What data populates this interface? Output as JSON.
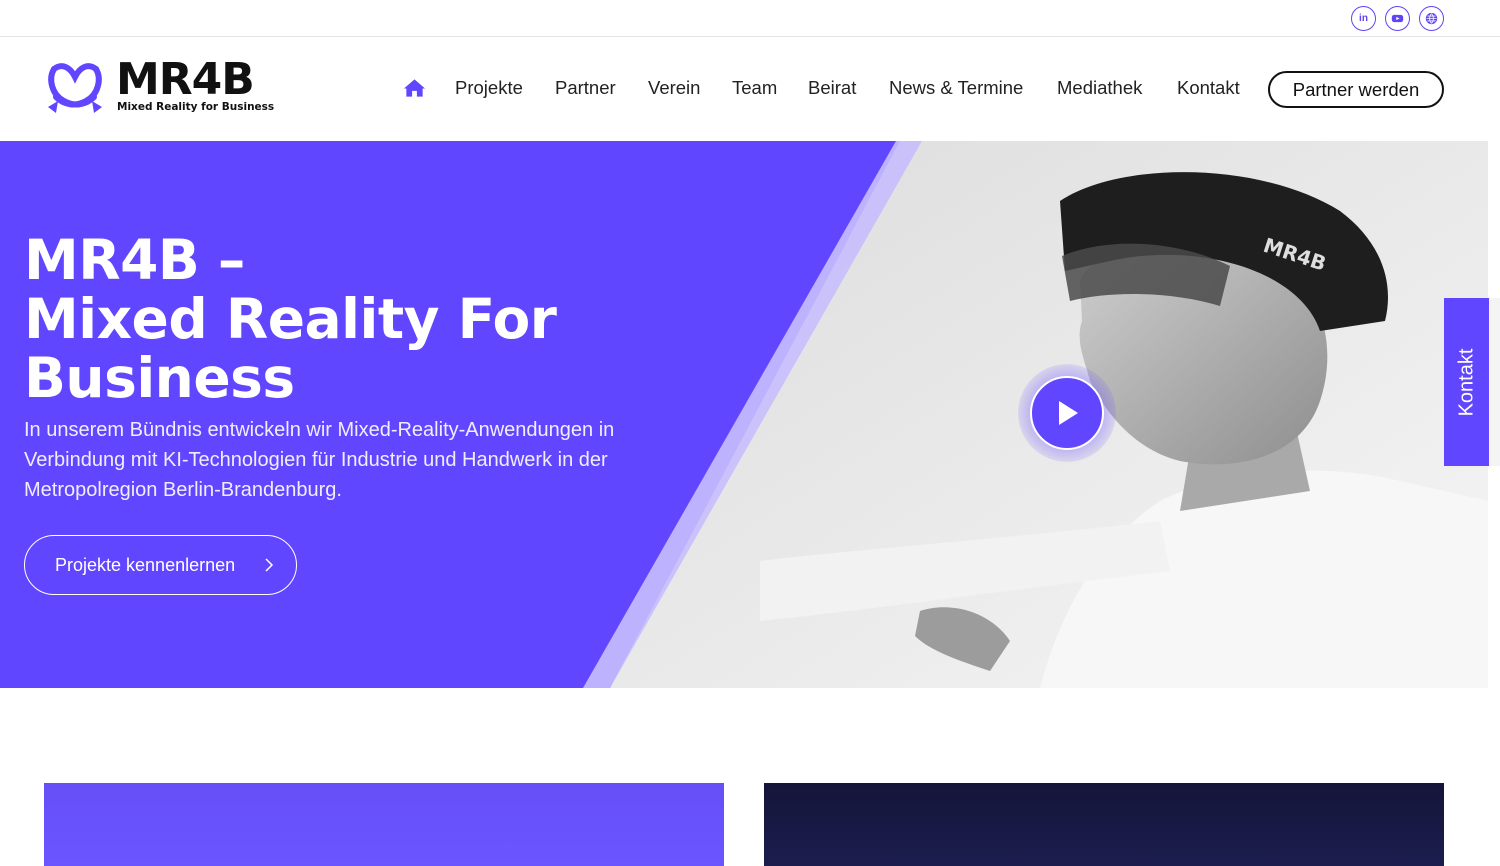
{
  "brand": {
    "logo_text": "MR4B",
    "tagline": "Mixed Reality for Business",
    "accent_color": "#6146ff"
  },
  "social": [
    {
      "icon": "linkedin-icon",
      "label": "in"
    },
    {
      "icon": "youtube-icon"
    },
    {
      "icon": "globe-icon"
    }
  ],
  "nav": {
    "home_icon": "home-icon",
    "items": [
      "Projekte",
      "Partner",
      "Verein",
      "Team",
      "Beirat",
      "News & Termine",
      "Mediathek",
      "Kontakt"
    ],
    "cta_label": "Partner werden"
  },
  "hero": {
    "title_lines": [
      "MR4B –",
      "Mixed Reality For",
      "Business"
    ],
    "text": "In unserem Bündnis entwickeln wir Mixed-Reality-Anwendungen in Verbindung mit KI-Technologien für Industrie und Handwerk in der Metropolregion Berlin-Brandenburg.",
    "button_label": "Projekte kennenlernen",
    "photo_headset_label": "MR4B"
  },
  "side_tab": {
    "label": "Kontakt"
  }
}
